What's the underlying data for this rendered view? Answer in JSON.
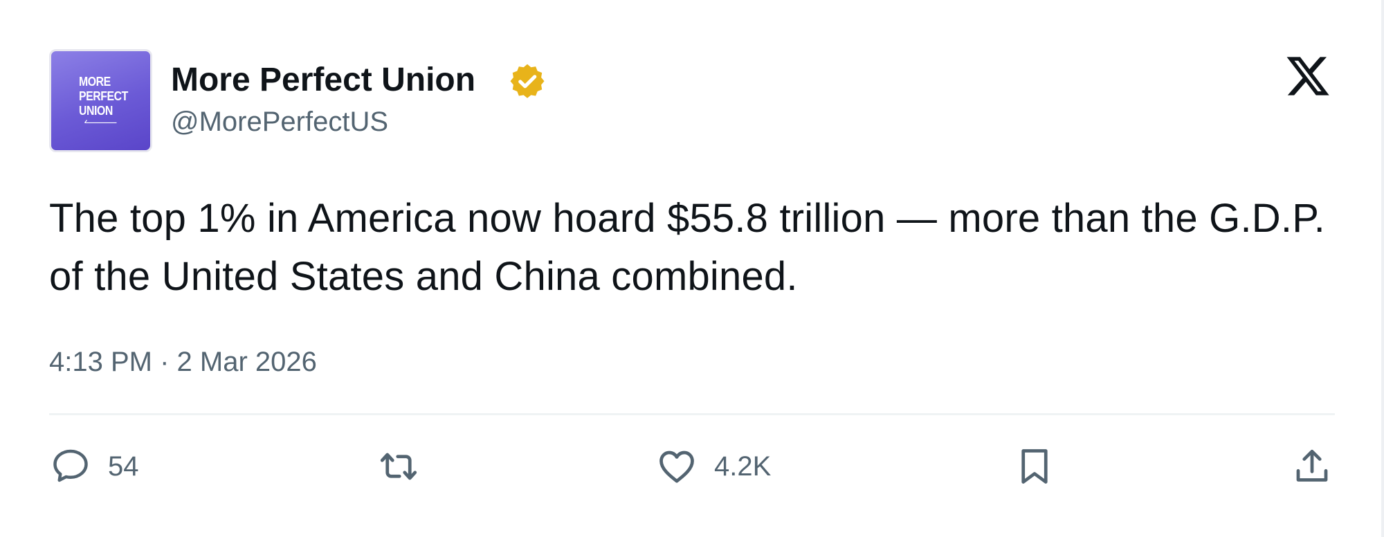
{
  "author": {
    "name": "More Perfect Union",
    "handle": "@MorePerfectUS",
    "avatar_text": [
      "MORE",
      "PERFECT",
      "UNION"
    ],
    "verified": true,
    "verified_color": "#e8b31a",
    "avatar_color": "#6b5ad6"
  },
  "tweet": {
    "text": "The top 1% in America now hoard $55.8 trillion — more than the G.D.P. of the United States and China combined.",
    "timestamp": "4:13 PM · 2 Mar 2026"
  },
  "actions": {
    "reply": {
      "icon": "speech-bubble-icon",
      "count": "54"
    },
    "retweet": {
      "icon": "repost-icon"
    },
    "like": {
      "icon": "heart-icon",
      "count": "4.2K"
    },
    "bookmark": {
      "icon": "bookmark-icon"
    },
    "share": {
      "icon": "share-icon"
    }
  },
  "brand": {
    "icon": "x-logo-icon"
  }
}
